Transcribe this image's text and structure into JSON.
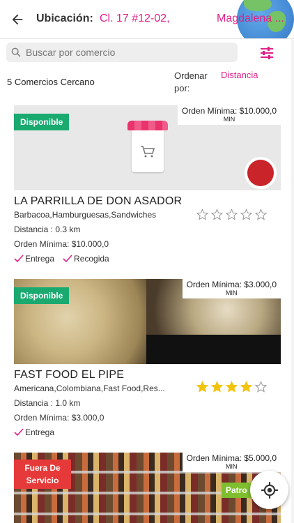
{
  "header": {
    "location_label": "Ubicación:",
    "location_value": "Cl. 17 #12-02,",
    "location_city": "Magdalena ..."
  },
  "search": {
    "placeholder": "Buscar por comercio"
  },
  "results": {
    "count_text": "5 Comercios Cercano",
    "order_label": "Ordenar por:",
    "order_value": "Distancia"
  },
  "stores": [
    {
      "status": "Disponible",
      "min_order_tag": "Orden Mínima: $10.000,0",
      "min_order_unit": "MIN",
      "name": "LA PARRILLA DE DON ASADOR",
      "categories": "Barbacoa,Hamburguesas,Sandwiches",
      "distance": "Distancia : 0.3 km",
      "min_order": "Orden Mínima: $10.000,0",
      "services": [
        "Entrega",
        "Recogida"
      ],
      "rating": 0
    },
    {
      "status": "Disponible",
      "min_order_tag": "Orden Mínima: $3.000,0",
      "min_order_unit": "MIN",
      "name": "FAST FOOD EL PIPE",
      "categories": "Americana,Colombiana,Fast Food,Res...",
      "distance": "Distancia : 1.0 km",
      "min_order": "Orden Mínima: $3.000,0",
      "services": [
        "Entrega"
      ],
      "rating": 4
    },
    {
      "status": "Fuera De Servicio",
      "min_order_tag": "Orden Mínima: $5.000,0",
      "min_order_unit": "MIN",
      "sponsor_badge": "Patro"
    }
  ],
  "icons": {
    "back": "arrow-left-icon",
    "search": "search-icon",
    "filter": "sliders-icon",
    "cart": "shopping-cart-icon",
    "check": "check-icon",
    "star": "star-icon",
    "locate": "crosshair-icon"
  },
  "colors": {
    "accent": "#e0218a",
    "available": "#1aaa70",
    "closed": "#e63a3a",
    "star": "#f2c30f"
  }
}
